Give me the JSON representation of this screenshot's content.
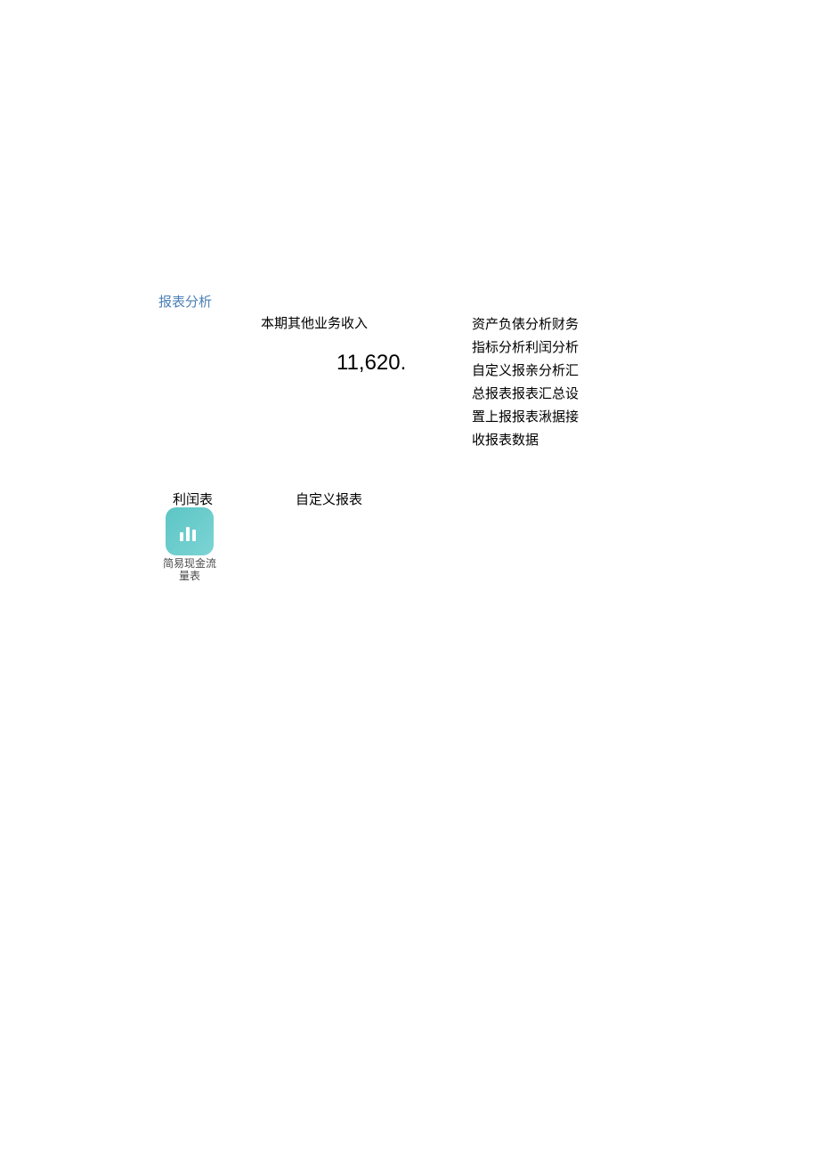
{
  "section_title": "报表分析",
  "metric": {
    "label": "本期其他业务收入",
    "value": "11,620."
  },
  "sidebar_text": "资产负俵分析财务指标分析利闰分析自定义报亲分析汇总报表报表汇总设置上报报表湫据接收报表数据",
  "cards": {
    "profit_table": "利闰表",
    "custom_report": "自定义报表",
    "cash_flow": "简易现金流量表"
  }
}
